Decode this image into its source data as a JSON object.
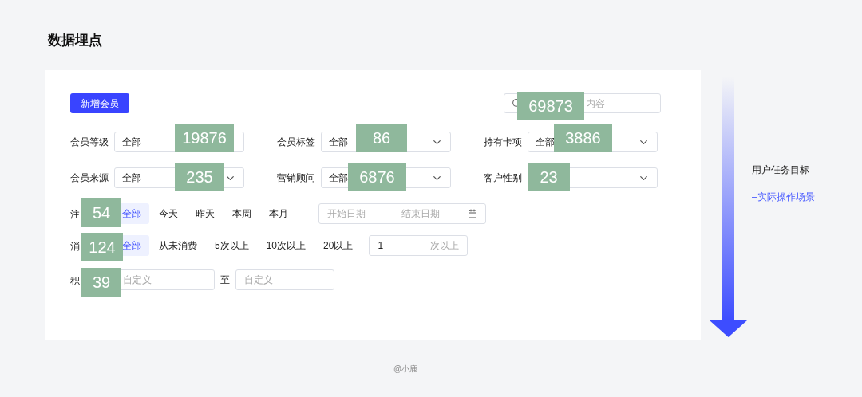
{
  "title": "数据埋点",
  "add_button": "新增会员",
  "search": {
    "placeholder": "内容"
  },
  "selects": [
    {
      "label": "会员等级",
      "value": "全部"
    },
    {
      "label": "会员标签",
      "value": "全部"
    },
    {
      "label": "持有卡项",
      "value": "全部"
    },
    {
      "label": "会员来源",
      "value": "全部"
    },
    {
      "label": "营销顾问",
      "value": "全部"
    },
    {
      "label": "客户性别"
    }
  ],
  "register_time": {
    "label": "注",
    "options": [
      {
        "label": "全部",
        "selected": true
      },
      {
        "label": "今天",
        "selected": false
      },
      {
        "label": "昨天",
        "selected": false
      },
      {
        "label": "本周",
        "selected": false
      },
      {
        "label": "本月",
        "selected": false
      }
    ],
    "start_placeholder": "开始日期",
    "separator": "–",
    "end_placeholder": "结束日期"
  },
  "consumption": {
    "label": "消",
    "options": [
      {
        "label": "全部",
        "selected": true
      },
      {
        "label": "从未消费",
        "selected": false
      },
      {
        "label": "5次以上",
        "selected": false
      },
      {
        "label": "10次以上",
        "selected": false
      },
      {
        "label": "20以上",
        "selected": false
      }
    ],
    "count_value": "1",
    "count_suffix": "次以上"
  },
  "points": {
    "label": "积",
    "min_placeholder": "自定义",
    "separator": "至",
    "max_placeholder": "自定义"
  },
  "badges": [
    {
      "text": "69873"
    },
    {
      "text": "19876"
    },
    {
      "text": "86"
    },
    {
      "text": "3886"
    },
    {
      "text": "235"
    },
    {
      "text": "6876"
    },
    {
      "text": "23"
    },
    {
      "text": "54"
    },
    {
      "text": "124"
    },
    {
      "text": "39"
    }
  ],
  "side": {
    "heading": "用户任务目标",
    "subheading": "–实际操作场景"
  },
  "credit": "@小鹿"
}
